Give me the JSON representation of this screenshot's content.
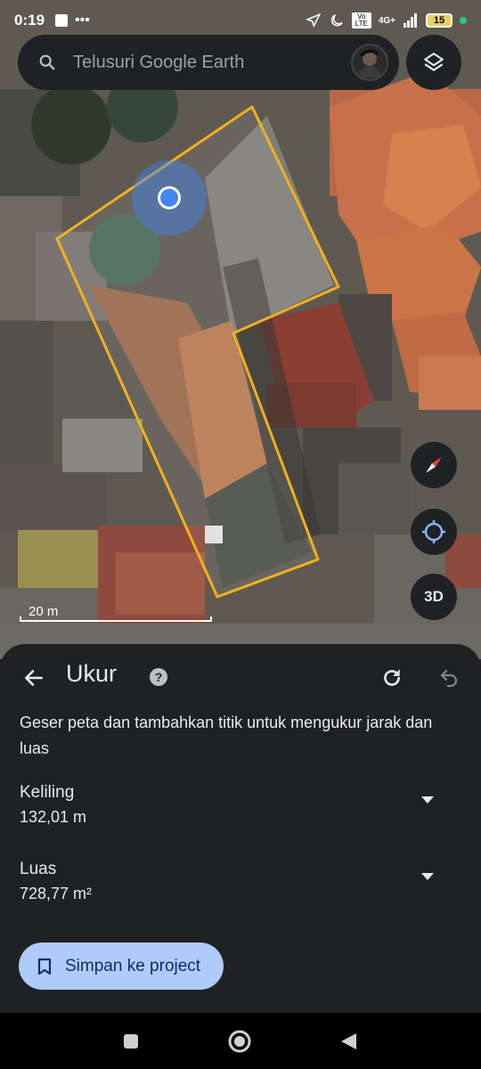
{
  "status_bar": {
    "time": "0:19",
    "network": "4G+",
    "volte": "Vo LTE",
    "battery": "15"
  },
  "search": {
    "placeholder": "Telusuri Google Earth"
  },
  "map": {
    "scale_label": "20 m",
    "compass_icon": "compass-icon",
    "locate_icon": "my-location-icon",
    "view_3d_label": "3D",
    "layers_icon": "layers-icon"
  },
  "measure_panel": {
    "title": "Ukur",
    "instructions": "Geser peta dan tambahkan titik untuk mengukur jarak dan luas",
    "perimeter": {
      "label": "Keliling",
      "value": "132,01 m"
    },
    "area": {
      "label": "Luas",
      "value": "728,77 m²"
    },
    "save_button": "Simpan ke project"
  },
  "colors": {
    "polygon_outline": "#f2b01e",
    "location_dot": "#4285f4",
    "save_button_bg": "#aecbfa",
    "panel_bg": "#202124"
  }
}
